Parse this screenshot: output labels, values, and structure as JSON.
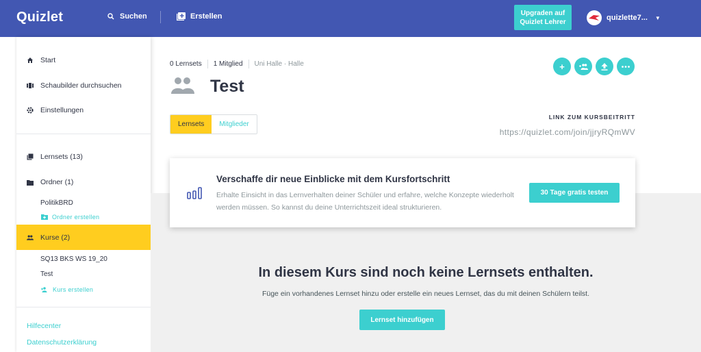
{
  "header": {
    "logo": "Quizlet",
    "search_label": "Suchen",
    "create_label": "Erstellen",
    "upgrade_label": "Upgraden auf Quizlet Lehrer",
    "username": "quizlette7..."
  },
  "sidebar": {
    "start": "Start",
    "diagrams": "Schaubilder durchsuchen",
    "settings": "Einstellungen",
    "sets": "Lernsets (13)",
    "folders": "Ordner (1)",
    "folder_item": "PolitikBRD",
    "create_folder": "Ordner erstellen",
    "classes": "Kurse (2)",
    "class_items": [
      "SQ13 BKS WS 19_20",
      "Test"
    ],
    "create_class": "Kurs erstellen",
    "help": "Hilfecenter",
    "privacy": "Datenschutzerklärung"
  },
  "class": {
    "sets_count": "0 Lernsets",
    "members_count": "1 Mitglied",
    "school": "Uni Halle · Halle",
    "title": "Test",
    "tab_sets": "Lernsets",
    "tab_members": "Mitglieder",
    "join_label": "LINK ZUM KURSBEITRITT",
    "join_url": "https://quizlet.com/join/jjryRQmWV"
  },
  "promo": {
    "title": "Verschaffe dir neue Einblicke mit dem Kursfortschritt",
    "text": "Erhalte Einsicht in das Lernverhalten deiner Schüler und erfahre, welche Konzepte wiederholt werden müssen. So kannst du deine Unterrichtszeit ideal strukturieren.",
    "button": "30 Tage gratis testen"
  },
  "empty": {
    "title": "In diesem Kurs sind noch keine Lernsets enthalten.",
    "text": "Füge ein vorhandenes Lernset hinzu oder erstelle ein neues Lernset, das du mit deinen Schülern teilst.",
    "button": "Lernset hinzufügen"
  },
  "colors": {
    "header_bg": "#4257b2",
    "accent": "#3ccfcf",
    "active": "#ffcd1f"
  }
}
